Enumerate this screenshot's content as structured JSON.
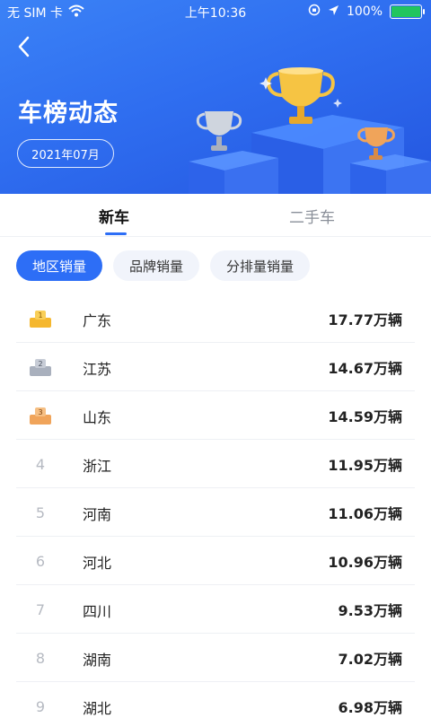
{
  "status_bar": {
    "carrier": "无 SIM 卡",
    "time": "上午10:36",
    "battery": "100%",
    "battery_level": 1.0,
    "battery_color": "#22c55e"
  },
  "header": {
    "title": "车榜动态",
    "date": "2021年07月",
    "background_color": "#2f6ef0"
  },
  "tabs": [
    {
      "label": "新车",
      "active": true
    },
    {
      "label": "二手车",
      "active": false
    }
  ],
  "filters": [
    {
      "label": "地区销量",
      "active": true
    },
    {
      "label": "品牌销量",
      "active": false
    },
    {
      "label": "分排量销量",
      "active": false
    }
  ],
  "ranking": [
    {
      "rank": "1",
      "region": "广东",
      "sales": "17.77万辆",
      "medal": "gold"
    },
    {
      "rank": "2",
      "region": "江苏",
      "sales": "14.67万辆",
      "medal": "silver"
    },
    {
      "rank": "3",
      "region": "山东",
      "sales": "14.59万辆",
      "medal": "bronze"
    },
    {
      "rank": "4",
      "region": "浙江",
      "sales": "11.95万辆"
    },
    {
      "rank": "5",
      "region": "河南",
      "sales": "11.06万辆"
    },
    {
      "rank": "6",
      "region": "河北",
      "sales": "10.96万辆"
    },
    {
      "rank": "7",
      "region": "四川",
      "sales": "9.53万辆"
    },
    {
      "rank": "8",
      "region": "湖南",
      "sales": "7.02万辆"
    },
    {
      "rank": "9",
      "region": "湖北",
      "sales": "6.98万辆"
    }
  ],
  "colors": {
    "accent": "#2d6ef6",
    "gold": "#f5b72e",
    "silver": "#a9b0bd",
    "bronze": "#f0a45a"
  }
}
